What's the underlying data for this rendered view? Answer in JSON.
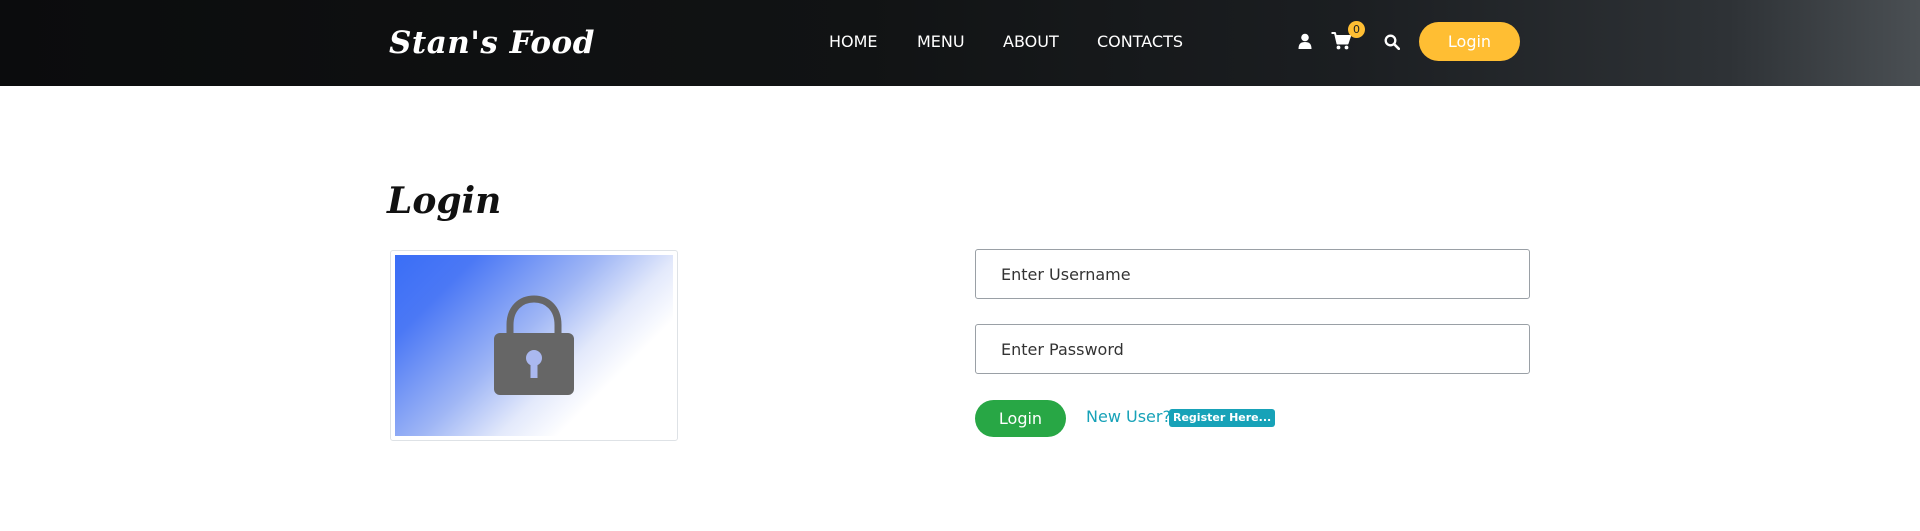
{
  "header": {
    "brand": "Stan's Food",
    "nav": [
      {
        "label": "HOME"
      },
      {
        "label": "MENU"
      },
      {
        "label": "ABOUT"
      },
      {
        "label": "CONTACTS"
      }
    ],
    "icons": {
      "user": "user-icon",
      "cart": "cart-icon",
      "search": "search-icon"
    },
    "cart_count": "0",
    "login_button": "Login"
  },
  "main": {
    "heading": "Login",
    "image_icon": "lock-icon",
    "username_placeholder": "Enter Username",
    "password_placeholder": "Enter Password",
    "submit_label": "Login",
    "new_user_text": "New User?",
    "register_link": "Register Here..."
  },
  "colors": {
    "accent": "#ffbe33",
    "success": "#28a745",
    "info": "#17a2b8",
    "header_bg": "#0b0c0d"
  }
}
